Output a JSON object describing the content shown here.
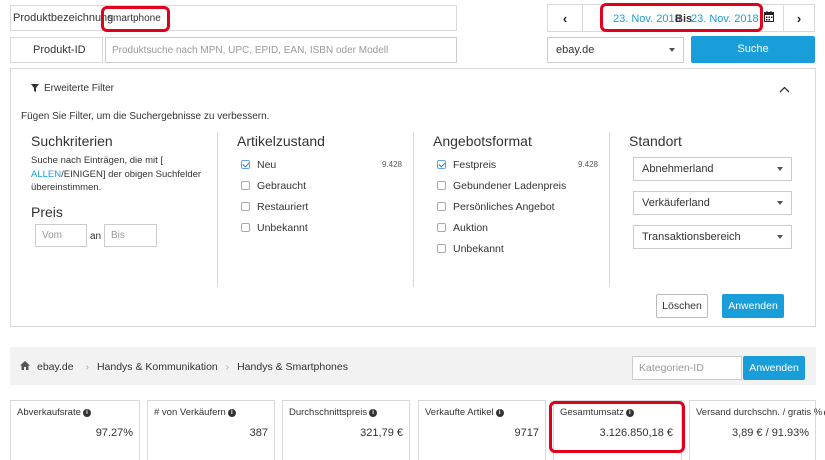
{
  "search": {
    "product_label": "Produktbezeichnung",
    "product_value": "smartphone",
    "product_id_label": "Produkt-ID",
    "product_id_placeholder": "Produktsuche nach MPN, UPC, EPID, EAN, ISBN oder Modell",
    "date_from": "23. Nov. 2018",
    "date_sep": "Bis",
    "date_to": "23. Nov. 2018",
    "site_value": "ebay.de",
    "search_button": "Suche"
  },
  "filter": {
    "title": "Erweiterte Filter",
    "hint": "Fügen Sie Filter, um die Suchergebnisse zu verbessern.",
    "criteria": {
      "title": "Suchkriterien",
      "text1": "Suche nach Einträgen, die mit [",
      "link_allen": "ALLEN",
      "slash": "/",
      "link_einigen": "EINIGEN",
      "text2": "] der obigen Suchfelder",
      "text3": "übereinstimmen."
    },
    "price": {
      "title": "Preis",
      "from_placeholder": "Vom",
      "sep": "an",
      "to_placeholder": "Bis"
    },
    "condition": {
      "title": "Artikelzustand",
      "items": [
        {
          "label": "Neu",
          "count": "9.428"
        },
        {
          "label": "Gebraucht",
          "count": ""
        },
        {
          "label": "Restauriert",
          "count": ""
        },
        {
          "label": "Unbekannt",
          "count": ""
        }
      ]
    },
    "format": {
      "title": "Angebotsformat",
      "items": [
        {
          "label": "Festpreis",
          "count": "9.428"
        },
        {
          "label": "Gebundener Ladenpreis",
          "count": ""
        },
        {
          "label": "Persönliches Angebot",
          "count": ""
        },
        {
          "label": "Auktion",
          "count": ""
        },
        {
          "label": "Unbekannt",
          "count": ""
        }
      ]
    },
    "location": {
      "title": "Standort",
      "selects": [
        "Abnehmerland",
        "Verkäuferland",
        "Transaktionsbereich"
      ]
    },
    "clear_button": "Löschen",
    "apply_button": "Anwenden"
  },
  "breadcrumb": {
    "items": [
      "ebay.de",
      "Handys & Kommunikation",
      "Handys & Smartphones"
    ],
    "category_placeholder": "Kategorien-ID",
    "apply_button": "Anwenden"
  },
  "stats": [
    {
      "label": "Abverkaufsrate",
      "value": "97.27%"
    },
    {
      "label": "# von Verkäufern",
      "value": "387"
    },
    {
      "label": "Durchschnittspreis",
      "value": "321,79 €"
    },
    {
      "label": "Verkaufte Artikel",
      "value": "9717"
    },
    {
      "label": "Gesamtumsatz",
      "value": "3.126.850,18 €"
    },
    {
      "label": "Versand durchschn. / gratis %",
      "value": "3,89 € / 91.93%"
    }
  ],
  "colors": {
    "accent": "#1a9ed9",
    "highlight": "#e0001b",
    "bar_bg": "#f2f2f2"
  },
  "icons": {
    "filter": "funnel-icon",
    "home": "home-icon",
    "calendar": "calendar-icon"
  }
}
